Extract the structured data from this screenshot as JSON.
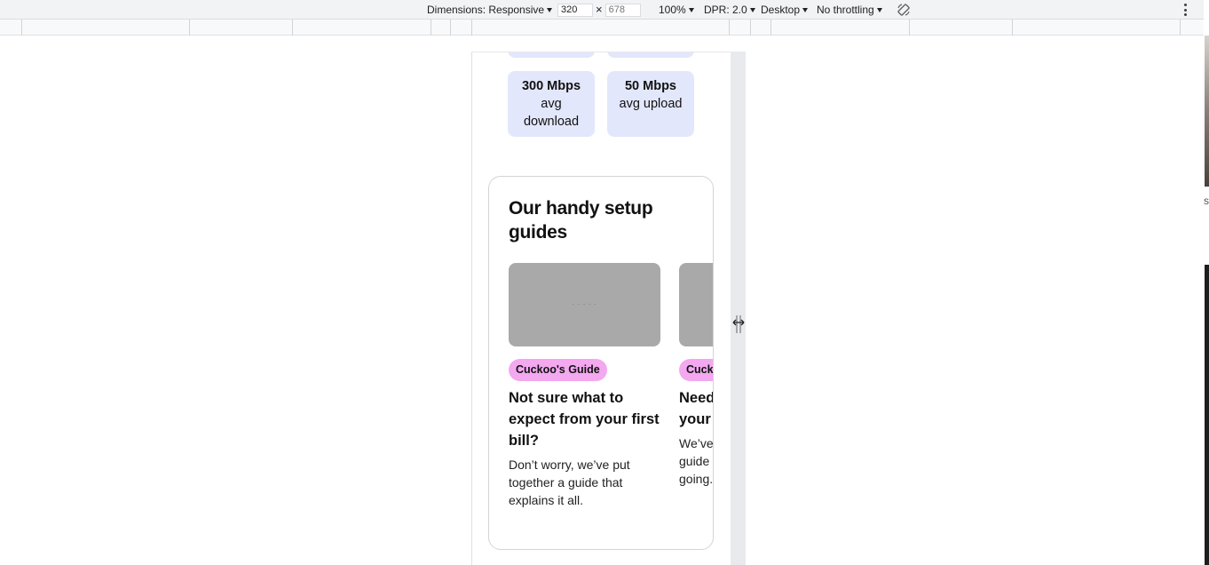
{
  "devtools": {
    "dimensions_label": "Dimensions: Responsive",
    "width_value": "320",
    "times_symbol": "×",
    "height_placeholder": "678",
    "zoom": "100%",
    "dpr": "DPR: 2.0",
    "device_type": "Desktop",
    "throttling": "No throttling",
    "rotate_icon": "rotate-icon",
    "more_icon": "more-vert-icon"
  },
  "edge_text": "s",
  "page": {
    "stats": [
      {
        "value": "300 Mbps",
        "label": "avg download"
      },
      {
        "value": "50 Mbps",
        "label": "avg upload"
      }
    ],
    "guides": {
      "title": "Our handy setup guides",
      "cards": [
        {
          "image_caption": "· · · · ·",
          "tag": "Cuckoo's Guide",
          "title": "Not sure what to expect from your first bill?",
          "body": "Don’t worry, we’ve put together a guide that explains it all."
        },
        {
          "image_caption": "",
          "tag": "Cuckoo's Guide",
          "title": "Need help setting up your broadband?",
          "body": "We’ve put together a clear guide to help you get it going."
        }
      ]
    }
  },
  "colors": {
    "stat_bg": "#e3e7fb",
    "tag_bg": "#f3a8f0",
    "image_placeholder": "#a9a9a9"
  }
}
